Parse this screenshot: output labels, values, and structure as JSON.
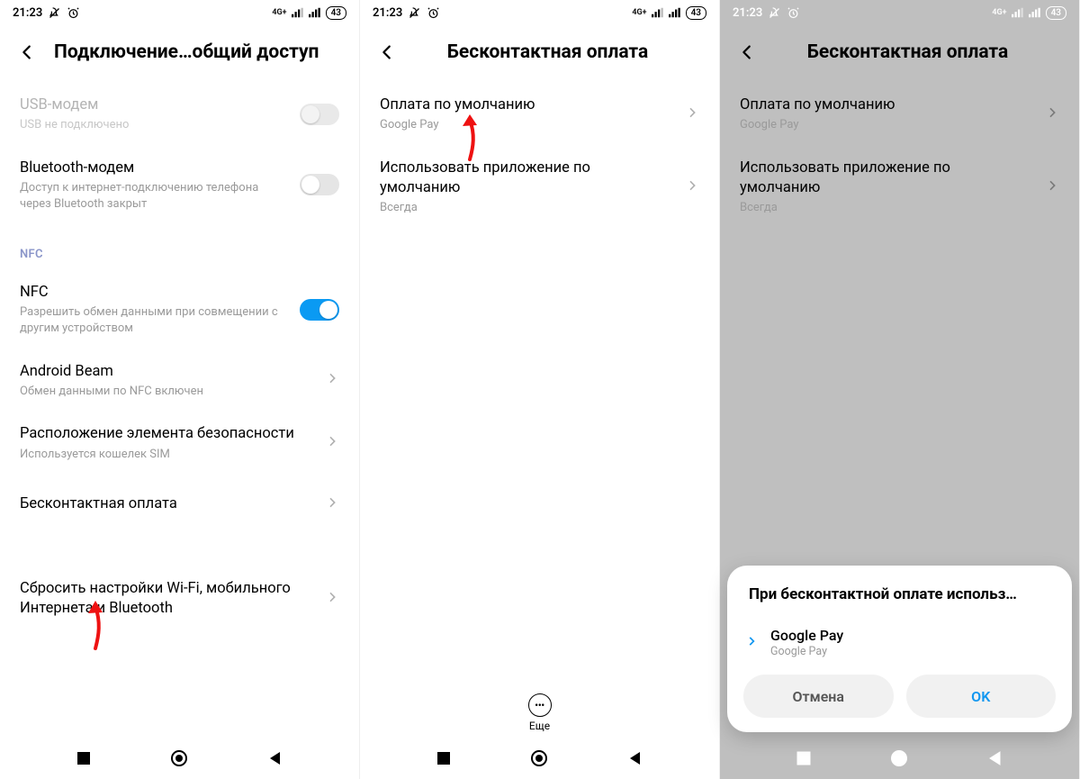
{
  "status": {
    "time": "21:23",
    "network_label": "4G+",
    "battery": "43"
  },
  "screen1": {
    "title": "Подключение…общий доступ",
    "usb": {
      "title": "USB-модем",
      "sub": "USB не подключено"
    },
    "bt": {
      "title": "Bluetooth-модем",
      "sub": "Доступ к интернет-подключению телефона через Bluetooth закрыт"
    },
    "section_nfc": "NFC",
    "nfc": {
      "title": "NFC",
      "sub": "Разрешить обмен данными при совмещении с другим устройством"
    },
    "beam": {
      "title": "Android Beam",
      "sub": "Обмен данными по NFC включен"
    },
    "sec": {
      "title": "Расположение элемента безопасности",
      "sub": "Используется кошелек SIM"
    },
    "contactless": {
      "title": "Бесконтактная оплата"
    },
    "reset": {
      "title": "Сбросить настройки Wi-Fi, мобильного Интернета и Bluetooth"
    }
  },
  "screen2": {
    "title": "Бесконтактная оплата",
    "default_pay": {
      "title": "Оплата по умолчанию",
      "sub": "Google Pay"
    },
    "use_default": {
      "title": "Использовать приложение по умолчанию",
      "sub": "Всегда"
    },
    "more_label": "Еще"
  },
  "screen3": {
    "title": "Бесконтактная оплата",
    "default_pay": {
      "title": "Оплата по умолчанию",
      "sub": "Google Pay"
    },
    "use_default": {
      "title": "Использовать приложение по умолчанию",
      "sub": "Всегда"
    },
    "sheet": {
      "title": "При бесконтактной оплате использ…",
      "option": {
        "title": "Google Pay",
        "sub": "Google Pay"
      },
      "cancel": "Отмена",
      "ok": "OK"
    }
  }
}
